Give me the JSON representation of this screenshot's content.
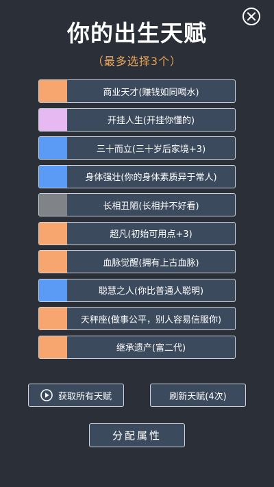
{
  "header": {
    "title": "你的出生天赋",
    "subtitle": "（最多选择3个）"
  },
  "talents": [
    {
      "label": "商业天才(赚钱如同喝水)",
      "color": "#f6a66e"
    },
    {
      "label": "开挂人生(开挂你懂的)",
      "color": "#e7b9f3"
    },
    {
      "label": "三十而立(三十岁后家境+3)",
      "color": "#5b9bf5"
    },
    {
      "label": "身体强壮(你的身体素质异于常人)",
      "color": "#5b9bf5"
    },
    {
      "label": "长相丑陋(长相并不好看)",
      "color": "#808387"
    },
    {
      "label": "超凡(初始可用点+3)",
      "color": "#f6a66e"
    },
    {
      "label": "血脉觉醒(拥有上古血脉)",
      "color": "#f6a66e"
    },
    {
      "label": "聪慧之人(你比普通人聪明)",
      "color": "#5b9bf5"
    },
    {
      "label": "天秤座(做事公平，别人容易信服你)",
      "color": "#f6a66e"
    },
    {
      "label": "继承遗产(富二代)",
      "color": "#f6a66e"
    }
  ],
  "buttons": {
    "get_all_label": "获取所有天赋",
    "refresh_label": "刷新天赋(4次)",
    "assign_label": "分配属性"
  },
  "icons": {
    "close": "close-icon",
    "play": "play-icon"
  }
}
